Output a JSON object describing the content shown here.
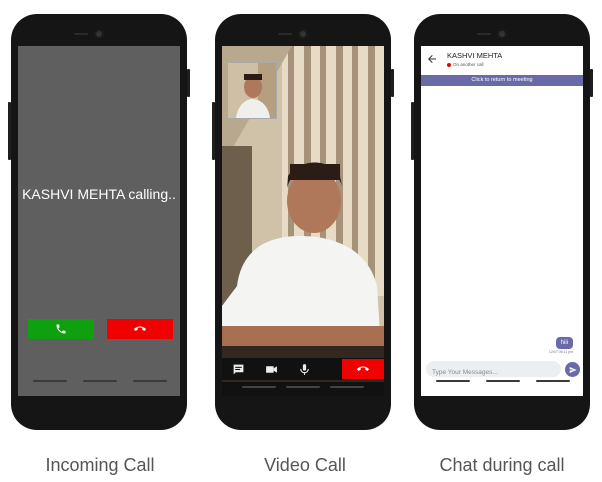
{
  "phones": [
    {
      "caption": "Incoming Call",
      "calling_text": "KASHVI MEHTA calling..",
      "icons": [
        "phone-accept-icon",
        "phone-decline-icon"
      ]
    },
    {
      "caption": "Video Call",
      "icons": [
        "chat-icon",
        "video-camera-icon",
        "microphone-icon",
        "end-call-icon"
      ]
    },
    {
      "caption": "Chat during call",
      "contact_name": "KASHVI MEHTA",
      "status": "On another call",
      "banner": "Click to return to meeting",
      "message_text": "hiii",
      "message_time": "12/07 06:11 pm",
      "input_placeholder": "Type Your Messages...",
      "icons": [
        "back-arrow-icon",
        "send-icon"
      ]
    }
  ],
  "colors": {
    "accept": "#0fa00f",
    "decline": "#f00000",
    "chat_accent": "#6a6aa8"
  }
}
